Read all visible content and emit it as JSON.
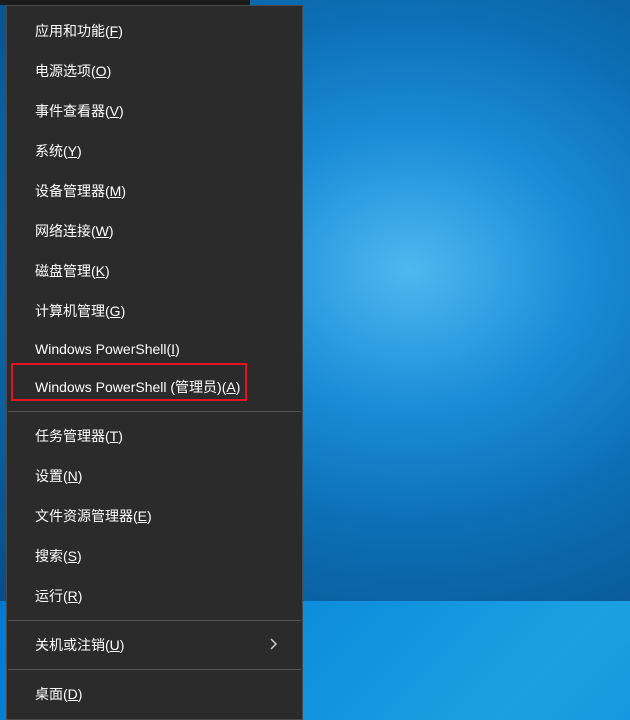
{
  "menu": {
    "items": [
      {
        "id": "apps-features",
        "text": "应用和功能(",
        "accel": "F",
        "suffix": ")"
      },
      {
        "id": "power-options",
        "text": "电源选项(",
        "accel": "O",
        "suffix": ")"
      },
      {
        "id": "event-viewer",
        "text": "事件查看器(",
        "accel": "V",
        "suffix": ")"
      },
      {
        "id": "system",
        "text": "系统(",
        "accel": "Y",
        "suffix": ")"
      },
      {
        "id": "device-manager",
        "text": "设备管理器(",
        "accel": "M",
        "suffix": ")"
      },
      {
        "id": "network-connections",
        "text": "网络连接(",
        "accel": "W",
        "suffix": ")"
      },
      {
        "id": "disk-management",
        "text": "磁盘管理(",
        "accel": "K",
        "suffix": ")"
      },
      {
        "id": "computer-management",
        "text": "计算机管理(",
        "accel": "G",
        "suffix": ")"
      },
      {
        "id": "powershell",
        "text": "Windows PowerShell(",
        "accel": "I",
        "suffix": ")"
      },
      {
        "id": "powershell-admin",
        "text": "Windows PowerShell (管理员)(",
        "accel": "A",
        "suffix": ")"
      },
      {
        "id": "task-manager",
        "text": "任务管理器(",
        "accel": "T",
        "suffix": ")"
      },
      {
        "id": "settings",
        "text": "设置(",
        "accel": "N",
        "suffix": ")"
      },
      {
        "id": "file-explorer",
        "text": "文件资源管理器(",
        "accel": "E",
        "suffix": ")"
      },
      {
        "id": "search",
        "text": "搜索(",
        "accel": "S",
        "suffix": ")"
      },
      {
        "id": "run",
        "text": "运行(",
        "accel": "R",
        "suffix": ")"
      },
      {
        "id": "shutdown-signout",
        "text": "关机或注销(",
        "accel": "U",
        "suffix": ")",
        "submenu": true
      },
      {
        "id": "desktop",
        "text": "桌面(",
        "accel": "D",
        "suffix": ")"
      }
    ]
  },
  "highlight": {
    "target": "powershell-admin"
  }
}
